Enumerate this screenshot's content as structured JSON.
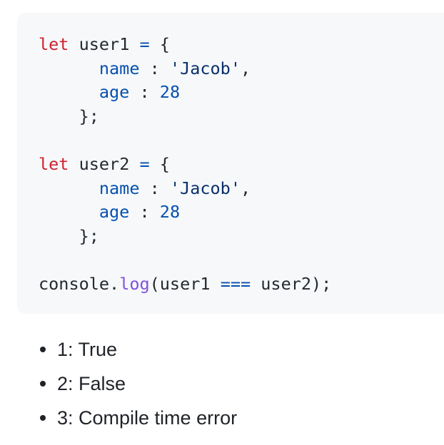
{
  "code": {
    "lines": [
      [
        {
          "t": "let",
          "c": "kw"
        },
        {
          "t": " user1 ",
          "c": ""
        },
        {
          "t": "=",
          "c": "op"
        },
        {
          "t": " {",
          "c": ""
        }
      ],
      [
        {
          "t": "      ",
          "c": ""
        },
        {
          "t": "name",
          "c": "prop"
        },
        {
          "t": " : ",
          "c": ""
        },
        {
          "t": "'Jacob'",
          "c": "str"
        },
        {
          "t": ",",
          "c": ""
        }
      ],
      [
        {
          "t": "      ",
          "c": ""
        },
        {
          "t": "age",
          "c": "prop"
        },
        {
          "t": " : ",
          "c": ""
        },
        {
          "t": "28",
          "c": "num"
        }
      ],
      [
        {
          "t": "    };",
          "c": ""
        }
      ],
      [
        {
          "t": "",
          "c": ""
        }
      ],
      [
        {
          "t": "let",
          "c": "kw"
        },
        {
          "t": " user2 ",
          "c": ""
        },
        {
          "t": "=",
          "c": "op"
        },
        {
          "t": " {",
          "c": ""
        }
      ],
      [
        {
          "t": "      ",
          "c": ""
        },
        {
          "t": "name",
          "c": "prop"
        },
        {
          "t": " : ",
          "c": ""
        },
        {
          "t": "'Jacob'",
          "c": "str"
        },
        {
          "t": ",",
          "c": ""
        }
      ],
      [
        {
          "t": "      ",
          "c": ""
        },
        {
          "t": "age",
          "c": "prop"
        },
        {
          "t": " : ",
          "c": ""
        },
        {
          "t": "28",
          "c": "num"
        }
      ],
      [
        {
          "t": "    };",
          "c": ""
        }
      ],
      [
        {
          "t": "",
          "c": ""
        }
      ],
      [
        {
          "t": "console.",
          "c": ""
        },
        {
          "t": "log",
          "c": "fn"
        },
        {
          "t": "(user1 ",
          "c": ""
        },
        {
          "t": "===",
          "c": "op"
        },
        {
          "t": " user2);",
          "c": ""
        }
      ]
    ]
  },
  "options": [
    {
      "label": "1: True"
    },
    {
      "label": "2: False"
    },
    {
      "label": "3: Compile time error"
    }
  ],
  "colors": {
    "keyword": "#cf222e",
    "property": "#0550ae",
    "string": "#0a3069",
    "function": "#8250df",
    "code_background": "#f6f8fa"
  }
}
